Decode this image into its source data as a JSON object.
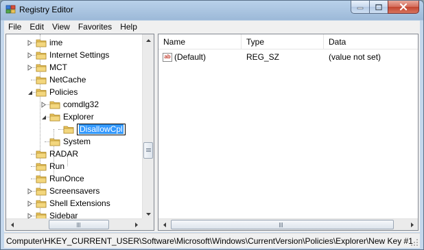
{
  "window": {
    "title": "Registry Editor"
  },
  "menu": [
    "File",
    "Edit",
    "View",
    "Favorites",
    "Help"
  ],
  "tree": {
    "items": [
      {
        "label": "ime",
        "expander": "collapsed",
        "level": 1
      },
      {
        "label": "Internet Settings",
        "expander": "collapsed",
        "level": 1
      },
      {
        "label": "MCT",
        "expander": "collapsed",
        "level": 1
      },
      {
        "label": "NetCache",
        "expander": "none",
        "level": 1
      },
      {
        "label": "Policies",
        "expander": "expanded",
        "level": 1
      },
      {
        "label": "comdlg32",
        "expander": "collapsed",
        "level": 2
      },
      {
        "label": "Explorer",
        "expander": "expanded",
        "level": 2
      },
      {
        "label": "DisallowCpl",
        "expander": "none",
        "level": 3,
        "editing": true
      },
      {
        "label": "System",
        "expander": "none",
        "level": 2
      },
      {
        "label": "RADAR",
        "expander": "none",
        "level": 1
      },
      {
        "label": "Run",
        "expander": "none",
        "level": 1
      },
      {
        "label": "RunOnce",
        "expander": "none",
        "level": 1
      },
      {
        "label": "Screensavers",
        "expander": "collapsed",
        "level": 1
      },
      {
        "label": "Shell Extensions",
        "expander": "collapsed",
        "level": 1
      },
      {
        "label": "Sidebar",
        "expander": "collapsed",
        "level": 1
      }
    ]
  },
  "list": {
    "columns": [
      "Name",
      "Type",
      "Data"
    ],
    "rows": [
      {
        "name": "(Default)",
        "type": "REG_SZ",
        "data": "(value not set)",
        "icon": "string-value-icon"
      }
    ]
  },
  "status": {
    "path": "Computer\\HKEY_CURRENT_USER\\Software\\Microsoft\\Windows\\CurrentVersion\\Policies\\Explorer\\New Key #1"
  },
  "colors": {
    "selection": "#3399ff",
    "folder": "#e8c25b"
  }
}
